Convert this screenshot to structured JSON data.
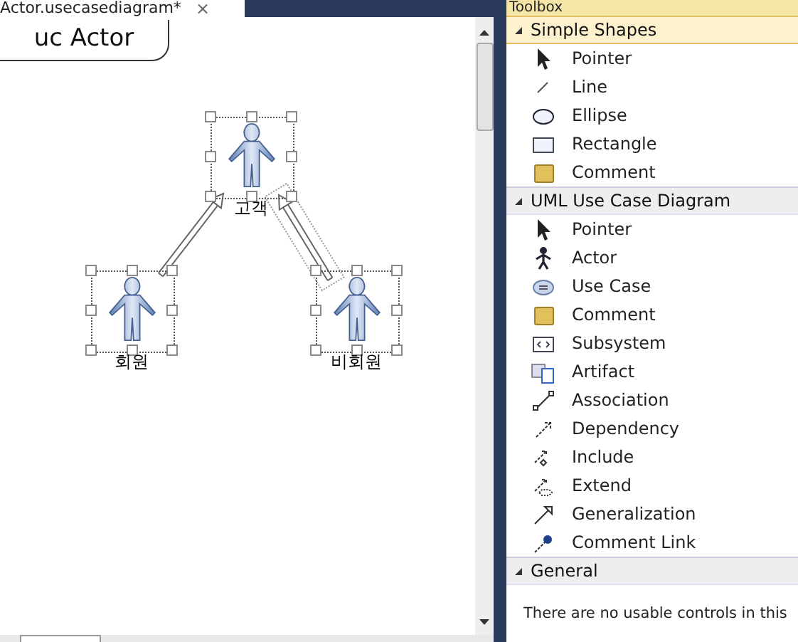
{
  "document_tab": {
    "title": "Actor.usecasediagram*",
    "close": "×",
    "selected": true
  },
  "diagram": {
    "frame_label": "uc Actor",
    "actors": [
      {
        "name": "고객",
        "selected": true,
        "children": [
          {
            "name": "회원",
            "selected": true,
            "link_selected": false
          },
          {
            "name": "비회원",
            "selected": true,
            "link_selected": true
          }
        ]
      }
    ]
  },
  "toolbox": {
    "title": "Toolbox",
    "sections": [
      {
        "title": "Simple Shapes",
        "expanded": true,
        "selected": true,
        "items": [
          {
            "label": "Pointer",
            "kind": "pointer"
          },
          {
            "label": "Line",
            "kind": "line"
          },
          {
            "label": "Ellipse",
            "kind": "ellipse"
          },
          {
            "label": "Rectangle",
            "kind": "rectangle"
          },
          {
            "label": "Comment",
            "kind": "comment"
          }
        ]
      },
      {
        "title": "UML Use Case Diagram",
        "expanded": true,
        "selected": false,
        "items": [
          {
            "label": "Pointer",
            "kind": "pointer"
          },
          {
            "label": "Actor",
            "kind": "actor"
          },
          {
            "label": "Use Case",
            "kind": "usecase"
          },
          {
            "label": "Comment",
            "kind": "comment"
          },
          {
            "label": "Subsystem",
            "kind": "subsystem"
          },
          {
            "label": "Artifact",
            "kind": "artifact"
          },
          {
            "label": "Association",
            "kind": "association"
          },
          {
            "label": "Dependency",
            "kind": "dependency"
          },
          {
            "label": "Include",
            "kind": "include"
          },
          {
            "label": "Extend",
            "kind": "extend"
          },
          {
            "label": "Generalization",
            "kind": "generalization"
          },
          {
            "label": "Comment Link",
            "kind": "commentlink"
          }
        ]
      },
      {
        "title": "General",
        "expanded": true,
        "selected": false,
        "message": "There are no usable controls in this"
      }
    ]
  }
}
